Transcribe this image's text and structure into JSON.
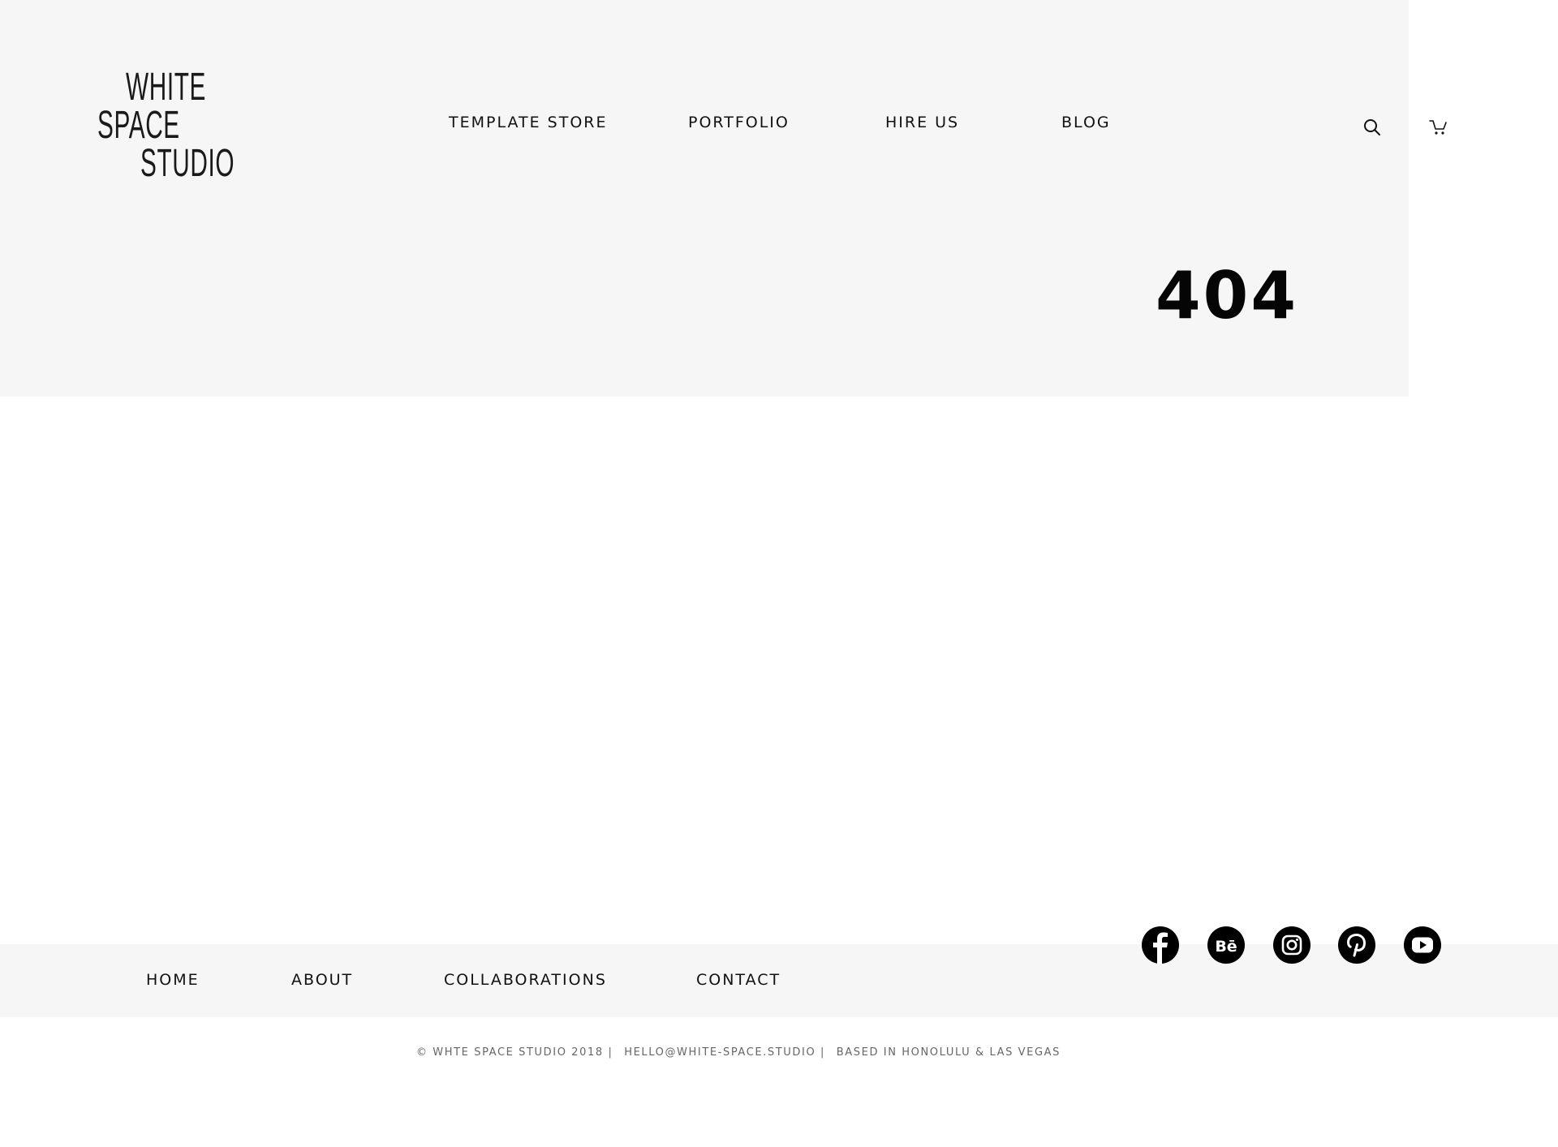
{
  "header": {
    "logo": {
      "line1": "WHITE",
      "line2": "SPACE",
      "line3": "STUDIO"
    },
    "nav": [
      {
        "label": "TEMPLATE STORE"
      },
      {
        "label": "PORTFOLIO"
      },
      {
        "label": "HIRE US"
      },
      {
        "label": "BLOG"
      }
    ],
    "icons": {
      "search": "search-icon",
      "cart": "cart-icon"
    }
  },
  "hero": {
    "error_code": "404"
  },
  "footer": {
    "nav": [
      {
        "label": "HOME"
      },
      {
        "label": "ABOUT"
      },
      {
        "label": "COLLABORATIONS"
      },
      {
        "label": "CONTACT"
      }
    ],
    "social": [
      {
        "icon": "facebook-icon"
      },
      {
        "icon": "behance-icon"
      },
      {
        "icon": "instagram-icon"
      },
      {
        "icon": "pinterest-icon"
      },
      {
        "icon": "youtube-icon"
      }
    ],
    "copyright": "© WHTE SPACE STUDIO 2018 |",
    "email": "HELLO@WHITE-SPACE.STUDIO |",
    "location": "BASED IN HONOLULU & LAS VEGAS"
  },
  "colors": {
    "band_background": "#f6f6f6",
    "page_background": "#ffffff",
    "text": "#111111",
    "muted_text": "#666666",
    "social_icon_fill": "#000000"
  }
}
